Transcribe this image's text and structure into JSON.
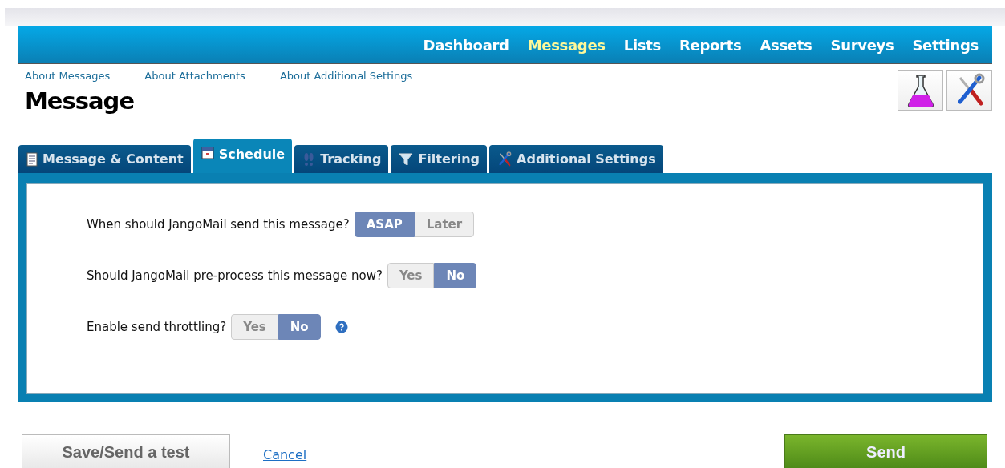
{
  "nav": [
    {
      "label": "Dashboard",
      "selected": false
    },
    {
      "label": "Messages",
      "selected": true
    },
    {
      "label": "Lists",
      "selected": false
    },
    {
      "label": "Reports",
      "selected": false
    },
    {
      "label": "Assets",
      "selected": false
    },
    {
      "label": "Surveys",
      "selected": false
    },
    {
      "label": "Settings",
      "selected": false
    }
  ],
  "help_links": [
    "About Messages",
    "About Attachments",
    "About Additional Settings"
  ],
  "title": "Message",
  "tool_buttons": [
    {
      "kind": "flask"
    },
    {
      "kind": "tools"
    }
  ],
  "tabs": [
    {
      "label": "Message & Content",
      "kind": "document",
      "selected": false
    },
    {
      "label": "Schedule",
      "kind": "calendar",
      "selected": true
    },
    {
      "label": "Tracking",
      "kind": "footprints",
      "selected": false
    },
    {
      "label": "Filtering",
      "kind": "funnel",
      "selected": false
    },
    {
      "label": "Additional Settings",
      "kind": "tools",
      "selected": false
    }
  ],
  "questions": [
    {
      "label": "When should JangoMail send this message?",
      "help": false,
      "options": [
        {
          "label": "ASAP",
          "selected": true
        },
        {
          "label": "Later",
          "selected": false
        }
      ]
    },
    {
      "label": "Should JangoMail pre-process this message now?",
      "help": false,
      "options": [
        {
          "label": "Yes",
          "selected": false
        },
        {
          "label": "No",
          "selected": true
        }
      ]
    },
    {
      "label": "Enable send throttling?",
      "help": true,
      "options": [
        {
          "label": "Yes",
          "selected": false
        },
        {
          "label": "No",
          "selected": true
        }
      ]
    }
  ],
  "footer": {
    "test_button": "Save/Send a test",
    "cancel_link": "Cancel",
    "send_button": "Send"
  }
}
